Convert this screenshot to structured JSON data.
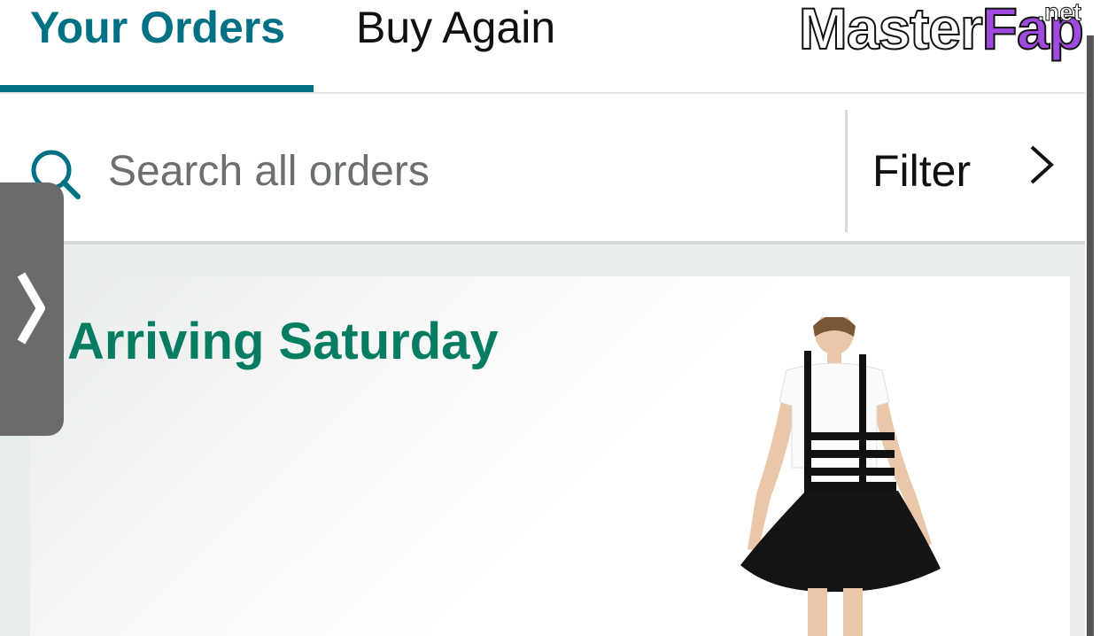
{
  "tabs": {
    "your_orders": "Your Orders",
    "buy_again": "Buy Again"
  },
  "watermark": {
    "word_a": "Master",
    "word_b": "Fap",
    "tld": ".net"
  },
  "search": {
    "placeholder": "Search all orders",
    "value": ""
  },
  "filter": {
    "label": "Filter",
    "icon": "chevron-right-icon"
  },
  "order_card": {
    "heading": "Arriving Saturday",
    "image": "product-image-black-suspender-skirt"
  },
  "drawer": {
    "icon": "chevron-right-icon"
  },
  "colors": {
    "accent_teal": "#007185",
    "arriving_green": "#067d62",
    "text_dark": "#0f1111",
    "text_muted": "#565959",
    "drawer_gray": "#6b6b6b"
  }
}
